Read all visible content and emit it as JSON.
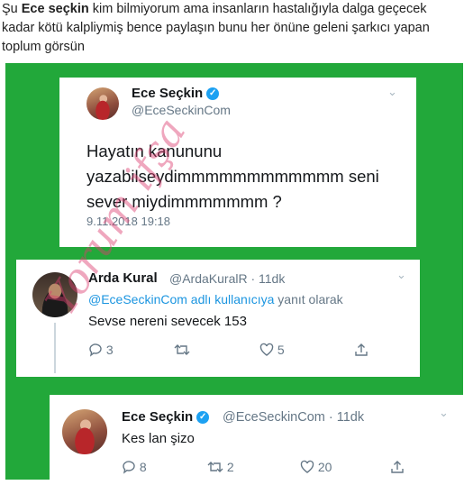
{
  "caption": {
    "part1": "Şu ",
    "bold_name": "Ece seçkin",
    "part2": " kim bilmiyorum ama insanların hastalığıyla dalga geçecek kadar kötü kalpliymiş bence paylaşın bunu her önüne geleni şarkıcı yapan toplum görsün"
  },
  "tweet1": {
    "name": "Ece Seçkin",
    "verified_glyph": "✓",
    "handle": "@EceSeckinCom",
    "chevron": "⌄",
    "text_line1": "Hayatın kanununu",
    "text_line2": "yazabilseydimmmmmmmmmmmm seni",
    "text_line3": "sever miydimmmmmmm ?",
    "date": "9.11.2018 19:18"
  },
  "tweet2": {
    "name": "Arda Kural",
    "handle": "@ArdaKuralR · 11dk",
    "chevron": "⌄",
    "reply_link": "@EceSeckinCom adlı kullanıcıya",
    "reply_suffix": " yanıt olarak",
    "text": "Sevse nereni sevecek 153",
    "reply_count": "3",
    "retweet_count": "",
    "like_count": "5"
  },
  "tweet3": {
    "name": "Ece Seçkin",
    "verified_glyph": "✓",
    "handle": "@EceSeckinCom · 11dk",
    "chevron": "⌄",
    "text": "Kes lan şizo",
    "reply_count": "8",
    "retweet_count": "2",
    "like_count": "20"
  },
  "watermark": {
    "text1": "Yorum ifşa",
    "color": "#db3c6e"
  },
  "icons": {
    "reply": "speech-bubble-icon",
    "retweet": "retweet-icon",
    "like": "heart-icon",
    "share": "share-icon"
  }
}
